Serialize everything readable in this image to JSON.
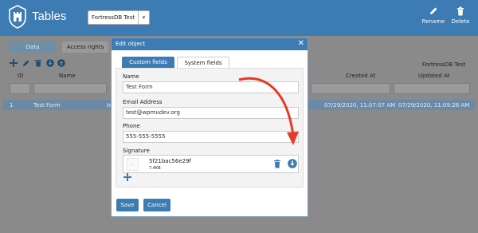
{
  "header": {
    "app_title": "Tables",
    "table_select_value": "FortressDB Test",
    "rename_label": "Rename",
    "delete_label": "Delete",
    "color": "#3d7bb3"
  },
  "tabs": {
    "data": "Data",
    "access": "Access rights"
  },
  "db_name": "FortressDB Test",
  "grid": {
    "columns": [
      "ID",
      "Name",
      "Created At",
      "Updated At"
    ],
    "rows": [
      {
        "id": "1",
        "name": "Test Form",
        "name2": "te",
        "created": "07/29/2020, 11:07:07 AM",
        "updated": "07/29/2020, 11:09:28 AM"
      }
    ]
  },
  "modal": {
    "title": "Edit object",
    "tabs": [
      "Custom fields",
      "System fields"
    ],
    "fields": {
      "name_label": "Name",
      "name_value": "Test Form",
      "email_label": "Email Address",
      "email_value": "test@wpmudev.org",
      "phone_label": "Phone",
      "phone_value": "555-555-5555",
      "signature_label": "Signature"
    },
    "signature": {
      "file_name": "5f21bac56e29f",
      "file_size": "7.4KB"
    },
    "save_label": "Save",
    "cancel_label": "Cancel"
  },
  "annotation_color": "#e53a2a"
}
